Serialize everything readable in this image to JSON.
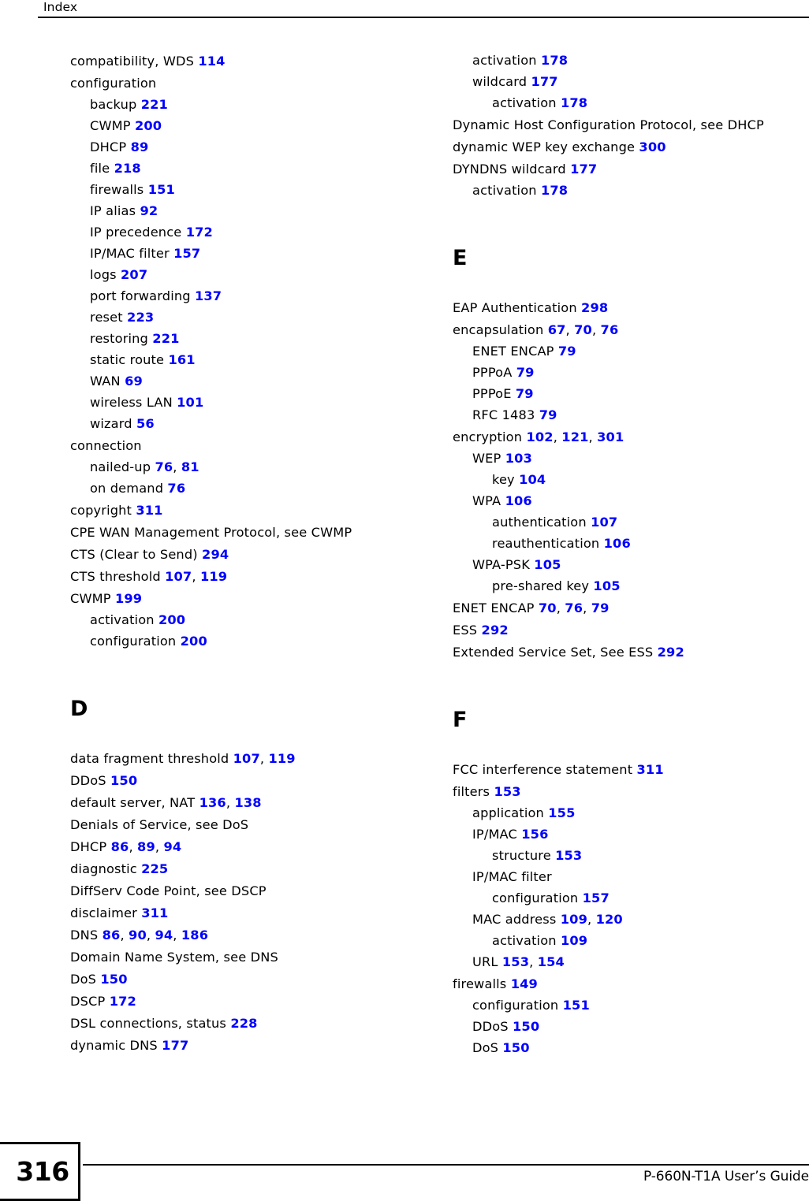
{
  "header": {
    "title": "Index"
  },
  "footer": {
    "page_number": "316",
    "guide_title": "P-660N-T1A User’s Guide"
  },
  "colors": {
    "page_number_link": "#0000ff",
    "text": "#000000",
    "rule": "#000000"
  },
  "columns": [
    {
      "id": "left",
      "blocks": [
        {
          "type": "entries",
          "items": [
            {
              "level": 0,
              "term": "compatibility, WDS",
              "pages": [
                "114"
              ]
            },
            {
              "level": 0,
              "term": "configuration",
              "pages": []
            },
            {
              "level": 1,
              "term": "backup",
              "pages": [
                "221"
              ]
            },
            {
              "level": 1,
              "term": "CWMP",
              "pages": [
                "200"
              ]
            },
            {
              "level": 1,
              "term": "DHCP",
              "pages": [
                "89"
              ]
            },
            {
              "level": 1,
              "term": "file",
              "pages": [
                "218"
              ]
            },
            {
              "level": 1,
              "term": "firewalls",
              "pages": [
                "151"
              ]
            },
            {
              "level": 1,
              "term": "IP alias",
              "pages": [
                "92"
              ]
            },
            {
              "level": 1,
              "term": "IP precedence",
              "pages": [
                "172"
              ]
            },
            {
              "level": 1,
              "term": "IP/MAC filter",
              "pages": [
                "157"
              ]
            },
            {
              "level": 1,
              "term": "logs",
              "pages": [
                "207"
              ]
            },
            {
              "level": 1,
              "term": "port forwarding",
              "pages": [
                "137"
              ]
            },
            {
              "level": 1,
              "term": "reset",
              "pages": [
                "223"
              ]
            },
            {
              "level": 1,
              "term": "restoring",
              "pages": [
                "221"
              ]
            },
            {
              "level": 1,
              "term": "static route",
              "pages": [
                "161"
              ]
            },
            {
              "level": 1,
              "term": "WAN",
              "pages": [
                "69"
              ]
            },
            {
              "level": 1,
              "term": "wireless LAN",
              "pages": [
                "101"
              ]
            },
            {
              "level": 1,
              "term": "wizard",
              "pages": [
                "56"
              ]
            },
            {
              "level": 0,
              "term": "connection",
              "pages": []
            },
            {
              "level": 1,
              "term": "nailed-up",
              "pages": [
                "76",
                "81"
              ]
            },
            {
              "level": 1,
              "term": "on demand",
              "pages": [
                "76"
              ]
            },
            {
              "level": 0,
              "term": "copyright",
              "pages": [
                "311"
              ]
            },
            {
              "level": 0,
              "term": "CPE WAN Management Protocol, see CWMP",
              "pages": []
            },
            {
              "level": 0,
              "term": "CTS (Clear to Send)",
              "pages": [
                "294"
              ]
            },
            {
              "level": 0,
              "term": "CTS threshold",
              "pages": [
                "107",
                "119"
              ]
            },
            {
              "level": 0,
              "term": "CWMP",
              "pages": [
                "199"
              ]
            },
            {
              "level": 1,
              "term": "activation",
              "pages": [
                "200"
              ]
            },
            {
              "level": 1,
              "term": "configuration",
              "pages": [
                "200"
              ]
            }
          ]
        },
        {
          "type": "letter",
          "letter": "D"
        },
        {
          "type": "entries",
          "items": [
            {
              "level": 0,
              "term": "data fragment threshold",
              "pages": [
                "107",
                "119"
              ]
            },
            {
              "level": 0,
              "term": "DDoS",
              "pages": [
                "150"
              ]
            },
            {
              "level": 0,
              "term": "default server, NAT",
              "pages": [
                "136",
                "138"
              ]
            },
            {
              "level": 0,
              "term": "Denials of Service, see DoS",
              "pages": []
            },
            {
              "level": 0,
              "term": "DHCP",
              "pages": [
                "86",
                "89",
                "94"
              ]
            },
            {
              "level": 0,
              "term": "diagnostic",
              "pages": [
                "225"
              ]
            },
            {
              "level": 0,
              "term": "DiffServ Code Point, see DSCP",
              "pages": []
            },
            {
              "level": 0,
              "term": "disclaimer",
              "pages": [
                "311"
              ]
            },
            {
              "level": 0,
              "term": "DNS",
              "pages": [
                "86",
                "90",
                "94",
                "186"
              ]
            },
            {
              "level": 0,
              "term": "Domain Name System, see DNS",
              "pages": []
            },
            {
              "level": 0,
              "term": "DoS",
              "pages": [
                "150"
              ]
            },
            {
              "level": 0,
              "term": "DSCP",
              "pages": [
                "172"
              ]
            },
            {
              "level": 0,
              "term": "DSL connections, status",
              "pages": [
                "228"
              ]
            },
            {
              "level": 0,
              "term": "dynamic DNS",
              "pages": [
                "177"
              ]
            }
          ]
        }
      ]
    },
    {
      "id": "right",
      "blocks": [
        {
          "type": "entries",
          "items": [
            {
              "level": 1,
              "term": "activation",
              "pages": [
                "178"
              ]
            },
            {
              "level": 1,
              "term": "wildcard",
              "pages": [
                "177"
              ]
            },
            {
              "level": 2,
              "term": "activation",
              "pages": [
                "178"
              ]
            },
            {
              "level": 0,
              "term": "Dynamic Host Configuration Protocol, see DHCP",
              "pages": []
            },
            {
              "level": 0,
              "term": "dynamic WEP key exchange",
              "pages": [
                "300"
              ]
            },
            {
              "level": 0,
              "term": "DYNDNS wildcard",
              "pages": [
                "177"
              ]
            },
            {
              "level": 1,
              "term": "activation",
              "pages": [
                "178"
              ]
            }
          ]
        },
        {
          "type": "letter",
          "letter": "E"
        },
        {
          "type": "entries",
          "items": [
            {
              "level": 0,
              "term": "EAP Authentication",
              "pages": [
                "298"
              ]
            },
            {
              "level": 0,
              "term": "encapsulation",
              "pages": [
                "67",
                "70",
                "76"
              ]
            },
            {
              "level": 1,
              "term": "ENET ENCAP",
              "pages": [
                "79"
              ]
            },
            {
              "level": 1,
              "term": "PPPoA",
              "pages": [
                "79"
              ]
            },
            {
              "level": 1,
              "term": "PPPoE",
              "pages": [
                "79"
              ]
            },
            {
              "level": 1,
              "term": "RFC 1483",
              "pages": [
                "79"
              ]
            },
            {
              "level": 0,
              "term": "encryption",
              "pages": [
                "102",
                "121",
                "301"
              ]
            },
            {
              "level": 1,
              "term": "WEP",
              "pages": [
                "103"
              ]
            },
            {
              "level": 2,
              "term": "key",
              "pages": [
                "104"
              ]
            },
            {
              "level": 1,
              "term": "WPA",
              "pages": [
                "106"
              ]
            },
            {
              "level": 2,
              "term": "authentication",
              "pages": [
                "107"
              ]
            },
            {
              "level": 2,
              "term": "reauthentication",
              "pages": [
                "106"
              ]
            },
            {
              "level": 1,
              "term": "WPA-PSK",
              "pages": [
                "105"
              ]
            },
            {
              "level": 2,
              "term": "pre-shared key",
              "pages": [
                "105"
              ]
            },
            {
              "level": 0,
              "term": "ENET ENCAP",
              "pages": [
                "70",
                "76",
                "79"
              ]
            },
            {
              "level": 0,
              "term": "ESS",
              "pages": [
                "292"
              ]
            },
            {
              "level": 0,
              "term": "Extended Service Set, See ESS",
              "pages": [
                "292"
              ]
            }
          ]
        },
        {
          "type": "letter",
          "letter": "F"
        },
        {
          "type": "entries",
          "items": [
            {
              "level": 0,
              "term": "FCC interference statement",
              "pages": [
                "311"
              ]
            },
            {
              "level": 0,
              "term": "filters",
              "pages": [
                "153"
              ]
            },
            {
              "level": 1,
              "term": "application",
              "pages": [
                "155"
              ]
            },
            {
              "level": 1,
              "term": "IP/MAC",
              "pages": [
                "156"
              ]
            },
            {
              "level": 2,
              "term": "structure",
              "pages": [
                "153"
              ]
            },
            {
              "level": 1,
              "term": "IP/MAC filter",
              "pages": []
            },
            {
              "level": 2,
              "term": "configuration",
              "pages": [
                "157"
              ]
            },
            {
              "level": 1,
              "term": "MAC address",
              "pages": [
                "109",
                "120"
              ]
            },
            {
              "level": 2,
              "term": "activation",
              "pages": [
                "109"
              ]
            },
            {
              "level": 1,
              "term": "URL",
              "pages": [
                "153",
                "154"
              ]
            },
            {
              "level": 0,
              "term": "firewalls",
              "pages": [
                "149"
              ]
            },
            {
              "level": 1,
              "term": "configuration",
              "pages": [
                "151"
              ]
            },
            {
              "level": 1,
              "term": "DDoS",
              "pages": [
                "150"
              ]
            },
            {
              "level": 1,
              "term": "DoS",
              "pages": [
                "150"
              ]
            }
          ]
        }
      ]
    }
  ]
}
